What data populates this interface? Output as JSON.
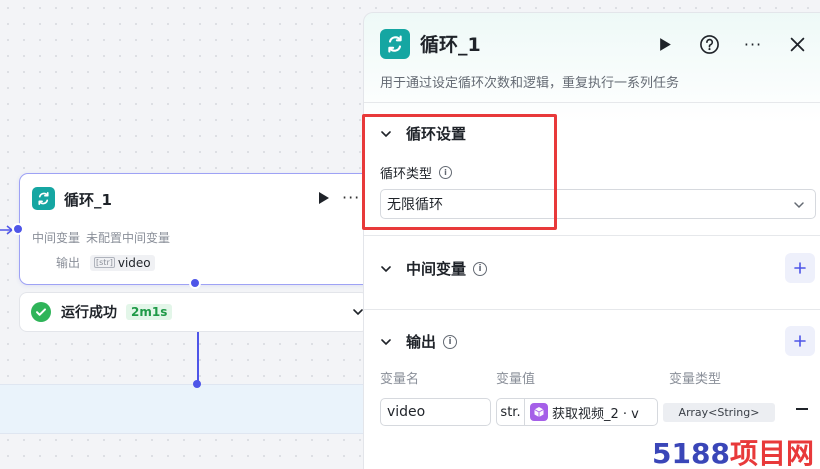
{
  "canvas": {
    "node": {
      "title": "循环_1",
      "row1_label": "中间变量",
      "row1_value": "未配置中间变量",
      "row2_label": "输出",
      "row2_tag_icon": "[str]",
      "row2_tag": "video"
    },
    "status": {
      "text": "运行成功",
      "time": "2m1s"
    }
  },
  "panel": {
    "title": "循环_1",
    "description": "用于通过设定循环次数和逻辑，重复执行一系列任务",
    "sections": {
      "loop_settings": {
        "title": "循环设置",
        "type_label": "循环类型",
        "type_value": "无限循环"
      },
      "variables": {
        "title": "中间变量"
      },
      "output": {
        "title": "输出",
        "columns": [
          "变量名",
          "变量值",
          "变量类型"
        ],
        "rows": [
          {
            "name": "video",
            "value_type": "str.",
            "value_ref": "获取视频_2 · v",
            "type": "Array<String>"
          }
        ]
      }
    }
  },
  "watermark": {
    "part1": "5188",
    "part2": "项目网"
  },
  "colors": {
    "accent": "#4e55e8",
    "loop_icon": "#15a6a2",
    "success": "#2fb459",
    "highlight": "#e8393a",
    "ref_icon": "#a55fe8"
  },
  "icons": [
    "loop-icon",
    "play-icon",
    "more-icon",
    "help-icon",
    "close-icon",
    "chevron-down-icon",
    "info-icon",
    "plus-icon",
    "check-icon",
    "cube-icon"
  ]
}
